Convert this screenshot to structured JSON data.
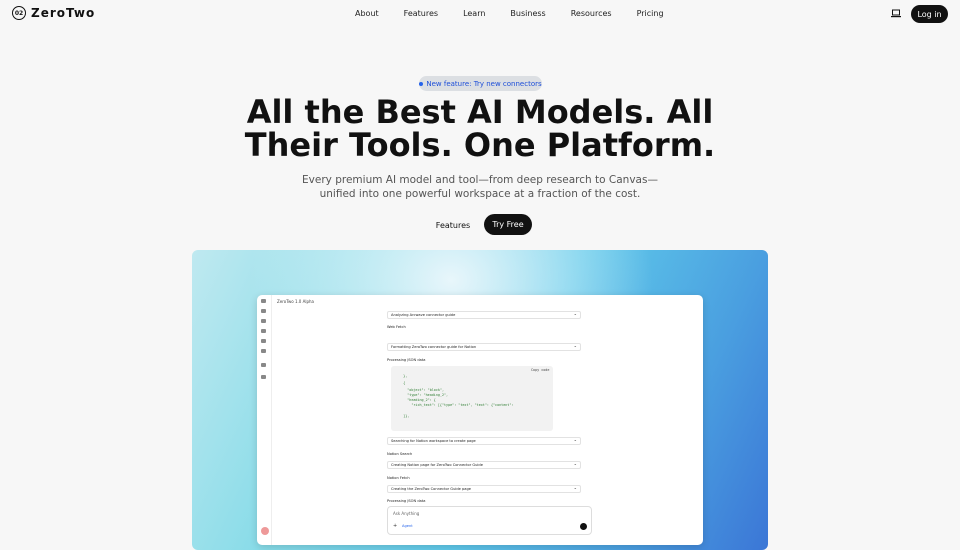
{
  "brand": {
    "logo_mark": "02",
    "name": "ZeroTwo"
  },
  "nav": {
    "items": [
      "About",
      "Features",
      "Learn",
      "Business",
      "Resources",
      "Pricing"
    ],
    "login": "Log in"
  },
  "announcement": {
    "text": "New feature: Try new connectors"
  },
  "hero": {
    "title": "All the Best AI Models. All Their Tools. One Platform.",
    "subtitle": "Every premium AI model and tool—from deep research to Canvas—unified into one powerful workspace at a fraction of the cost.",
    "secondary_cta": "Features",
    "primary_cta": "Try Free"
  },
  "app_preview": {
    "title": "ZeroTwo 1.0 Alpha",
    "steps": [
      "Analyzing Arcwave connector guide",
      "Web Fetch",
      "Formatting ZeroTwo connector guide for Notion",
      "Processing JSON data",
      "Searching for Notion workspace to create page",
      "Notion Search",
      "Creating Notion page for ZeroTwo Connector Guide",
      "Notion Fetch",
      "Creating the ZeroTwo Connector Guide page",
      "Processing JSON data"
    ],
    "code_header": "Copy code",
    "chat_placeholder": "Ask Anything",
    "agent_label": "Agent"
  }
}
